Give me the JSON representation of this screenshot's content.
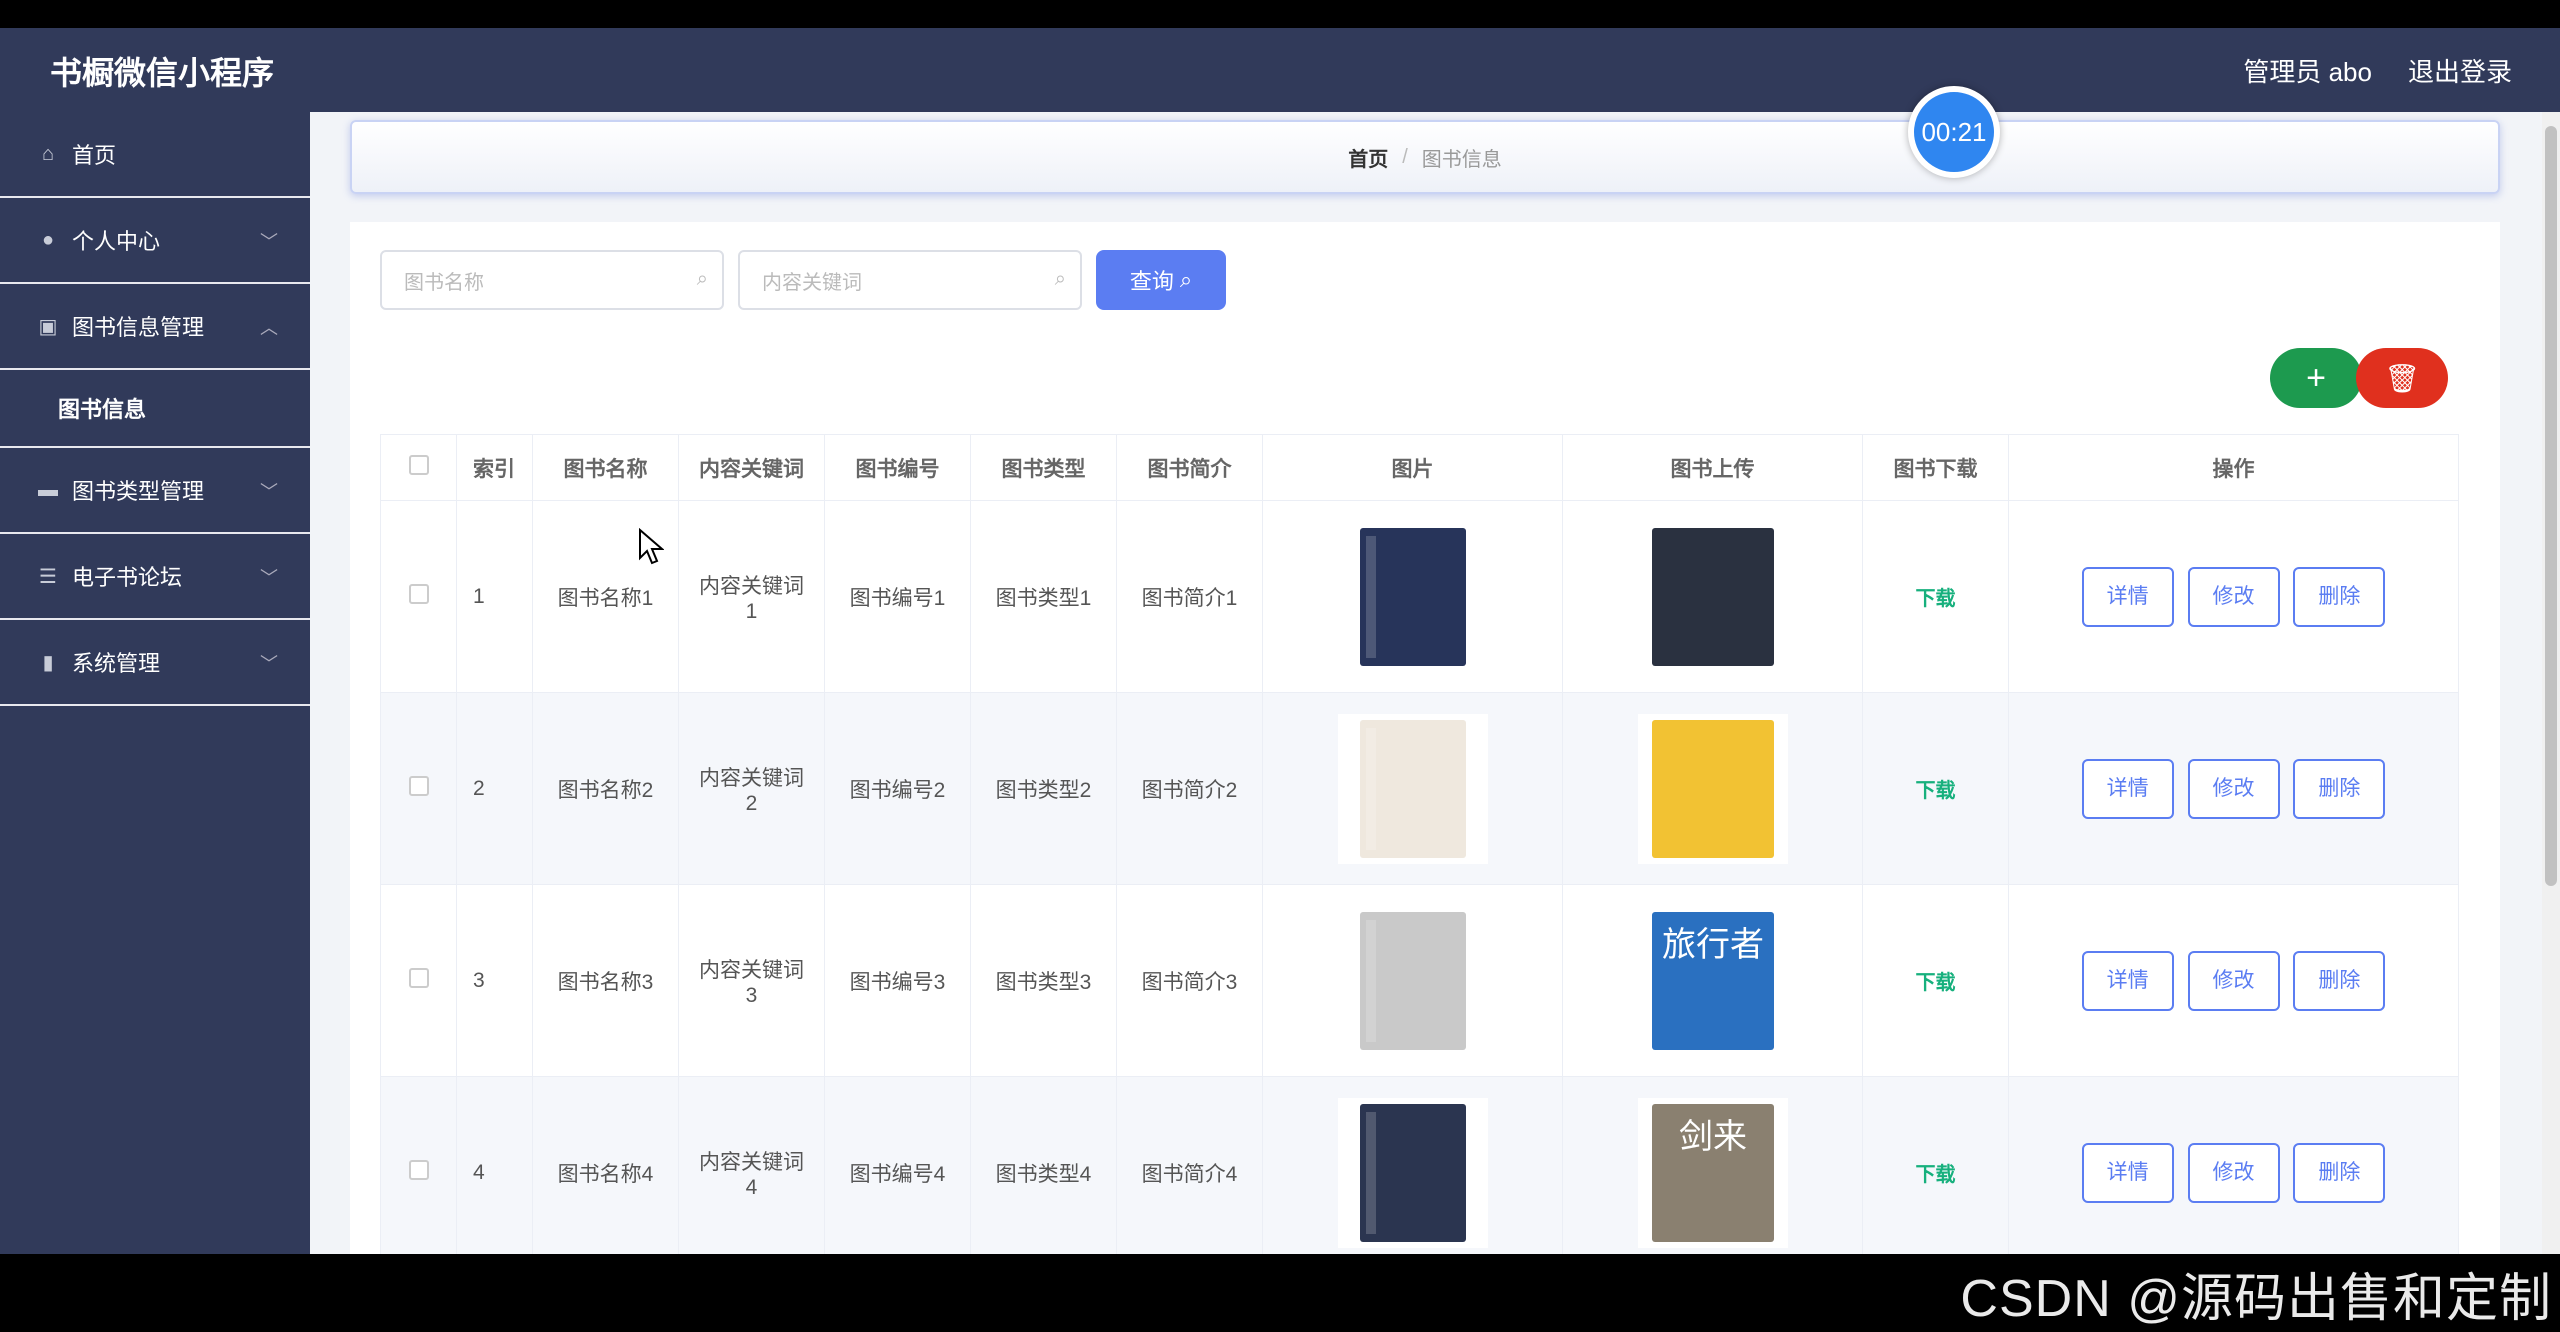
{
  "app": {
    "title": "书橱微信小程序"
  },
  "header": {
    "user": "管理员 abo",
    "logout": "退出登录"
  },
  "timer": "00:21",
  "sidebar": {
    "items": [
      {
        "label": "首页",
        "icon": "home-icon"
      },
      {
        "label": "个人中心",
        "icon": "user-icon"
      },
      {
        "label": "图书信息管理",
        "icon": "clipboard-icon",
        "sub": "图书信息"
      },
      {
        "label": "图书类型管理",
        "icon": "chat-icon"
      },
      {
        "label": "电子书论坛",
        "icon": "sliders-icon"
      },
      {
        "label": "系统管理",
        "icon": "tag-icon"
      }
    ]
  },
  "breadcrumb": {
    "home": "首页",
    "sep": "/",
    "current": "图书信息"
  },
  "search": {
    "name_placeholder": "图书名称",
    "keyword_placeholder": "内容关键词",
    "query": "查询"
  },
  "table": {
    "headers": [
      "索引",
      "图书名称",
      "内容关键词",
      "图书编号",
      "图书类型",
      "图书简介",
      "图片",
      "图书上传",
      "图书下载",
      "操作"
    ],
    "download": "下载",
    "actions": [
      "详情",
      "修改",
      "删除"
    ],
    "rows": [
      {
        "idx": "1",
        "name": "图书名称1",
        "kw_a": "内容关键词",
        "kw_b": "1",
        "no": "图书编号1",
        "type": "图书类型1",
        "intro": "图书简介1",
        "cover1_color": "#27345a",
        "cover2_color": "#2a3140"
      },
      {
        "idx": "2",
        "name": "图书名称2",
        "kw_a": "内容关键词",
        "kw_b": "2",
        "no": "图书编号2",
        "type": "图书类型2",
        "intro": "图书简介2",
        "cover1_color": "#efe8de",
        "cover2_color": "#f2c233"
      },
      {
        "idx": "3",
        "name": "图书名称3",
        "kw_a": "内容关键词",
        "kw_b": "3",
        "no": "图书编号3",
        "type": "图书类型3",
        "intro": "图书简介3",
        "cover1_color": "#c9c9c9",
        "cover2_color": "#2a70c0",
        "cover2_text": "旅行者"
      },
      {
        "idx": "4",
        "name": "图书名称4",
        "kw_a": "内容关键词",
        "kw_b": "4",
        "no": "图书编号4",
        "type": "图书类型4",
        "intro": "图书简介4",
        "cover1_color": "#2b3550",
        "cover2_color": "#8a8070",
        "cover2_text": "剑来"
      }
    ]
  },
  "watermark": "CSDN @源码出售和定制"
}
